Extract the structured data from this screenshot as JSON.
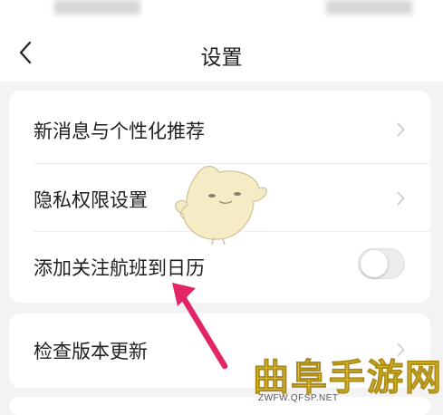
{
  "nav": {
    "title": "设置"
  },
  "groups": [
    {
      "items": [
        {
          "label": "新消息与个性化推荐",
          "control": "chevron"
        },
        {
          "label": "隐私权限设置",
          "control": "chevron"
        },
        {
          "label": "添加关注航班到日历",
          "control": "toggle",
          "toggle_on": false
        }
      ]
    },
    {
      "items": [
        {
          "label": "检查版本更新",
          "control": "chevron"
        }
      ]
    }
  ],
  "watermark": {
    "text": "曲阜手游网",
    "url": "ZWFW.QFSP.NET"
  },
  "colors": {
    "arrow": "#e22566",
    "watermark": "#f7d53a",
    "mascot": "#f5ecc6"
  }
}
